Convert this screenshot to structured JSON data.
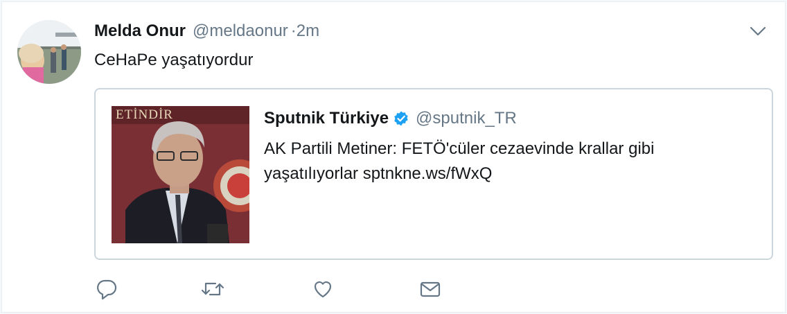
{
  "tweet": {
    "author_name": "Melda Onur",
    "author_handle": "@meldaonur",
    "time": "·2m",
    "text": "CeHaPe yaşatıyordur"
  },
  "quote": {
    "author_name": "Sputnik Türkiye",
    "author_handle": "@sputnik_TR",
    "text": "AK Partili Metiner: FETÖ'cüler cezaevinde krallar gibi yaşatılıyorlar sptnkne.ws/fWxQ",
    "image_sign_text": "ETİNDİR"
  },
  "icons": {
    "caret": "chevron-down-icon",
    "verified": "verified-badge-icon",
    "reply": "reply-icon",
    "retweet": "retweet-icon",
    "like": "heart-icon",
    "dm": "envelope-icon"
  },
  "colors": {
    "text": "#14171a",
    "secondary": "#657786",
    "verified": "#1da1f2",
    "border": "#ccd6dd",
    "icon": "#657786"
  }
}
